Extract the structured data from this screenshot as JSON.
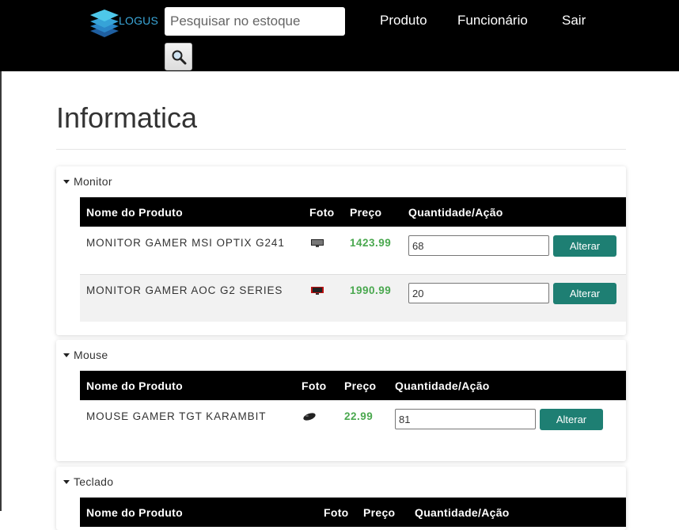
{
  "brand": {
    "name": "LOGUS"
  },
  "search": {
    "placeholder": "Pesquisar no estoque"
  },
  "nav": {
    "produto": "Produto",
    "funcionario": "Funcionário",
    "sair": "Sair"
  },
  "page": {
    "title": "Informatica"
  },
  "table_headers": {
    "name": "Nome do Produto",
    "photo": "Foto",
    "price": "Preço",
    "qty": "Quantidade/Ação"
  },
  "button": {
    "alter": "Alterar"
  },
  "categories": [
    {
      "name": "Monitor",
      "products": [
        {
          "name": "MONITOR GAMER MSI OPTIX G241",
          "price": "1423.99",
          "quantity": "68"
        },
        {
          "name": "MONITOR GAMER AOC G2 SERIES",
          "price": "1990.99",
          "quantity": "20"
        }
      ]
    },
    {
      "name": "Mouse",
      "products": [
        {
          "name": "MOUSE GAMER TGT KARAMBIT",
          "price": "22.99",
          "quantity": "81"
        }
      ]
    },
    {
      "name": "Teclado",
      "products": []
    }
  ],
  "colors": {
    "topbar": "#000000",
    "accent_button": "#1e7f73",
    "price_text": "#4aa84f",
    "logo": "#3ba7d9"
  }
}
